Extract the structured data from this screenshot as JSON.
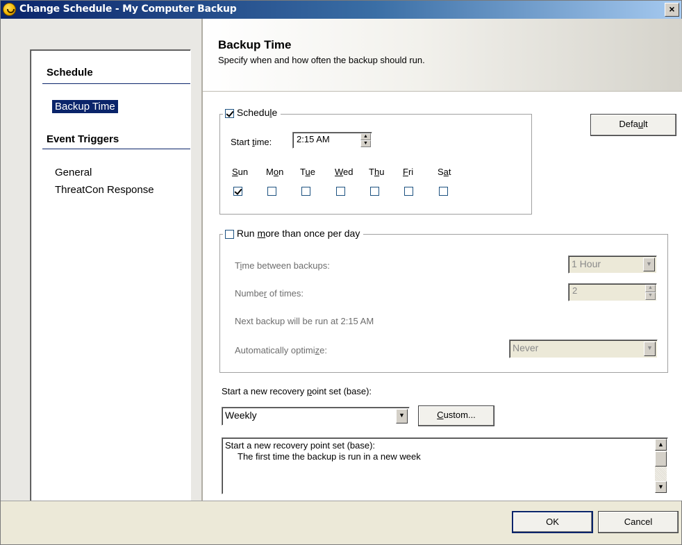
{
  "window": {
    "title": "Change Schedule - My Computer Backup",
    "close_glyph": "×"
  },
  "nav": {
    "section_schedule": "Schedule",
    "item_backup_time": "Backup Time",
    "section_event_triggers": "Event Triggers",
    "item_general": "General",
    "item_threatcon": "ThreatCon Response"
  },
  "header": {
    "title": "Backup Time",
    "subtitle": "Specify when and how often the backup should run."
  },
  "schedule": {
    "legend_pre": "Schedu",
    "legend_u": "l",
    "legend_post": "e",
    "checked": true,
    "start_time_label_pre": "Start ",
    "start_time_label_u": "t",
    "start_time_label_post": "ime:",
    "start_time_value": "2:15 AM",
    "days": [
      {
        "pre": "",
        "u": "S",
        "post": "un",
        "checked": true
      },
      {
        "pre": "M",
        "u": "o",
        "post": "n",
        "checked": false
      },
      {
        "pre": "T",
        "u": "u",
        "post": "e",
        "checked": false
      },
      {
        "pre": "",
        "u": "W",
        "post": "ed",
        "checked": false
      },
      {
        "pre": "T",
        "u": "h",
        "post": "u",
        "checked": false
      },
      {
        "pre": "",
        "u": "F",
        "post": "ri",
        "checked": false
      },
      {
        "pre": "S",
        "u": "a",
        "post": "t",
        "checked": false
      }
    ]
  },
  "default_button": {
    "pre": "Defa",
    "u": "u",
    "post": "lt"
  },
  "run_more": {
    "legend_pre": "Run ",
    "legend_u": "m",
    "legend_post": "ore than once per day",
    "checked": false,
    "time_between_pre": "T",
    "time_between_u": "i",
    "time_between_post": "me between backups:",
    "time_between_value": "1 Hour",
    "number_pre": "Numbe",
    "number_u": "r",
    "number_post": " of times:",
    "number_value": "2",
    "next_backup": "Next backup will be run at 2:15 AM",
    "optimize_pre": "Automatically optimi",
    "optimize_u": "z",
    "optimize_post": "e:",
    "optimize_value": "Never"
  },
  "recovery": {
    "label_pre": "Start a new recovery ",
    "label_u": "p",
    "label_post": "oint set (base):",
    "value": "Weekly",
    "custom_u": "C",
    "custom_post": "ustom...",
    "desc_line1": "Start a new recovery point set (base):",
    "desc_line2": "The first time the backup is run in a new week"
  },
  "footer": {
    "ok": "OK",
    "cancel": "Cancel"
  },
  "icons": {
    "dropdown": "▼",
    "spin_up": "▲",
    "spin_down": "▼"
  }
}
